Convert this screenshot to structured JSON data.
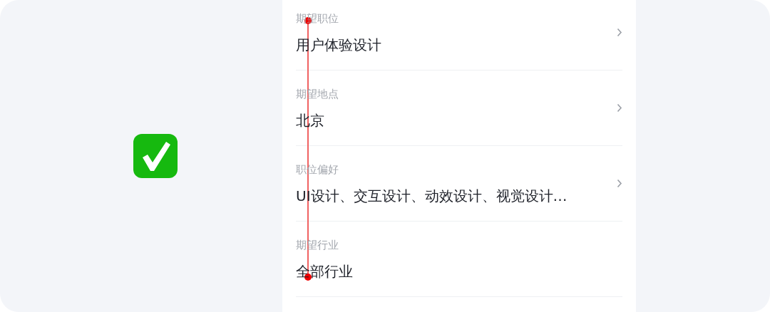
{
  "fields": [
    {
      "label": "期望职位",
      "value": "用户体验设计",
      "arrow": true
    },
    {
      "label": "期望地点",
      "value": "北京",
      "arrow": true
    },
    {
      "label": "职位偏好",
      "value": "UI设计、交互设计、动效设计、视觉设计…",
      "arrow": true
    },
    {
      "label": "期望行业",
      "value": "全部行业",
      "arrow": false
    }
  ]
}
